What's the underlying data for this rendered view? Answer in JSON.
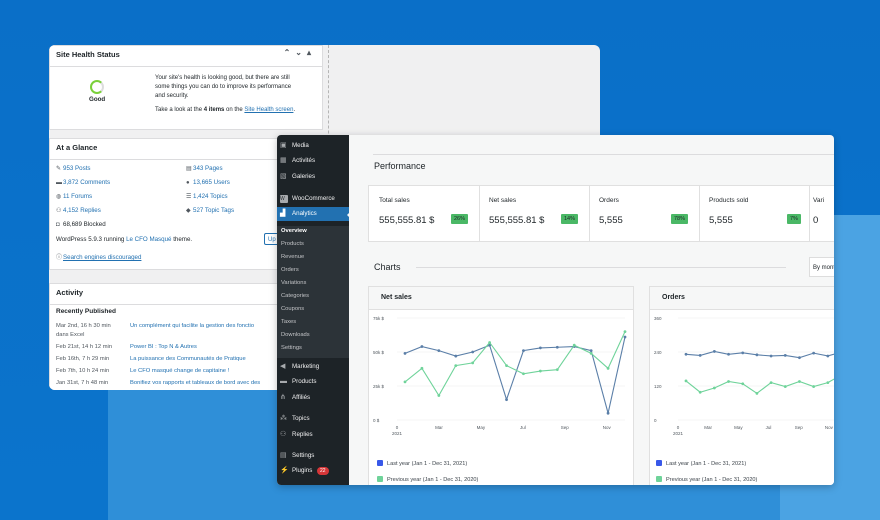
{
  "site_health": {
    "title": "Site Health Status",
    "status": "Good",
    "desc_1": "Your site's health is looking good, but there are still",
    "desc_2": "some things you can do to improve its performance",
    "desc_3": "and security.",
    "items_prefix": "Take a look at the ",
    "items_count": "4 items",
    "items_on": " on the ",
    "items_link": "Site Health screen",
    "items_end": "."
  },
  "glance": {
    "title": "At a Glance",
    "posts": "953 Posts",
    "pages": "343 Pages",
    "comments": "3,872 Comments",
    "users": "13,665 Users",
    "forums": "11 Forums",
    "topics": "1,424 Topics",
    "replies": "4,152 Replies",
    "topic_tags": "527 Topic Tags",
    "blocked": "68,689 Blocked",
    "running_prefix": "WordPress 5.9.3 running ",
    "theme": "Le CFO Masqué",
    "running_suffix": " theme.",
    "update_btn": "Up",
    "search_discouraged": "Search engines discouraged"
  },
  "activity": {
    "title": "Activity",
    "recent": "Recently Published",
    "rows": [
      {
        "date": "Mar 2nd, 16 h 30 min",
        "title": "Un complément qui facilite la gestion des fonctio"
      },
      {
        "date": "dans Excel",
        "title": ""
      },
      {
        "date": "Feb 21st, 14 h 12 min",
        "title": "Power BI : Top N & Autres"
      },
      {
        "date": "Feb 16th, 7 h 29 min",
        "title": "La puissance des Communautés de Pratique"
      },
      {
        "date": "Feb 7th, 10 h 24 min",
        "title": "Le CFO masqué change de capitaine !"
      },
      {
        "date": "Jan 31st, 7 h 48 min",
        "title": "Bonifiez vos rapports et tableaux de bord avec des"
      }
    ]
  },
  "sidebar": {
    "items": [
      {
        "label": "Media",
        "icon": "media-icon"
      },
      {
        "label": "Activités",
        "icon": "activity-icon"
      },
      {
        "label": "Galeries",
        "icon": "gallery-icon"
      },
      {
        "label": "WooCommerce",
        "icon": "woocommerce-icon"
      },
      {
        "label": "Analytics",
        "icon": "analytics-icon"
      }
    ],
    "submenu": [
      "Overview",
      "Products",
      "Revenue",
      "Orders",
      "Variations",
      "Categories",
      "Coupons",
      "Taxes",
      "Downloads",
      "Settings"
    ],
    "items2": [
      {
        "label": "Marketing",
        "icon": "megaphone-icon"
      },
      {
        "label": "Products",
        "icon": "products-icon"
      },
      {
        "label": "Affiliés",
        "icon": "affiliates-icon"
      },
      {
        "label": "Topics",
        "icon": "topics-icon"
      },
      {
        "label": "Replies",
        "icon": "replies-icon"
      },
      {
        "label": "Settings",
        "icon": "settings-icon"
      },
      {
        "label": "Plugins",
        "icon": "plugins-icon",
        "badge": "22"
      }
    ]
  },
  "performance": {
    "title": "Performance",
    "cards": [
      {
        "label": "Total sales",
        "value": "555,555.81 $",
        "delta": "26%"
      },
      {
        "label": "Net sales",
        "value": "555,555.81 $",
        "delta": "14%"
      },
      {
        "label": "Orders",
        "value": "5,555",
        "delta": "78%"
      },
      {
        "label": "Products sold",
        "value": "5,555",
        "delta": "7%"
      },
      {
        "label": "Vari",
        "value": "0",
        "delta": ""
      }
    ]
  },
  "charts": {
    "title": "Charts",
    "by_button": "By mont",
    "legend_last": "Last year (Jan 1 - Dec 31, 2021)",
    "legend_prev": "Previous year (Jan 1 - Dec 31, 2020)",
    "colors": {
      "last_year": "#5b7fa8",
      "previous_year": "#6fd39a"
    }
  },
  "chart_data": [
    {
      "type": "line",
      "title": "Net sales",
      "x_ticks": [
        "0\n2021",
        "Mar",
        "May",
        "Jul",
        "Sep",
        "Nov"
      ],
      "y_ticks": [
        "0 $",
        "25k $",
        "50k $",
        "75k $"
      ],
      "ylim": [
        0,
        75000
      ],
      "series": [
        {
          "name": "Last year (Jan 1 - Dec 31, 2021)",
          "values": [
            49000,
            54000,
            51000,
            47000,
            50000,
            55000,
            15000,
            51000,
            53000,
            53500,
            54000,
            51000,
            5000,
            61000
          ]
        },
        {
          "name": "Previous year (Jan 1 - Dec 31, 2020)",
          "values": [
            28000,
            38000,
            18000,
            40000,
            42000,
            57000,
            40000,
            34000,
            36000,
            37000,
            55000,
            49000,
            38000,
            65000
          ]
        }
      ]
    },
    {
      "type": "line",
      "title": "Orders",
      "x_ticks": [
        "0\n2021",
        "Mar",
        "May",
        "Jul",
        "Sep",
        "Nov"
      ],
      "y_ticks": [
        "0",
        "120",
        "240",
        "360"
      ],
      "ylim": [
        0,
        360
      ],
      "series": [
        {
          "name": "Last year (Jan 1 - Dec 31, 2021)",
          "values": [
            232,
            228,
            242,
            232,
            237,
            230,
            226,
            228,
            220,
            236,
            226,
            240
          ]
        },
        {
          "name": "Previous year (Jan 1 - Dec 31, 2020)",
          "values": [
            138,
            98,
            113,
            136,
            128,
            94,
            132,
            118,
            136,
            118,
            132,
            160
          ]
        }
      ]
    }
  ]
}
